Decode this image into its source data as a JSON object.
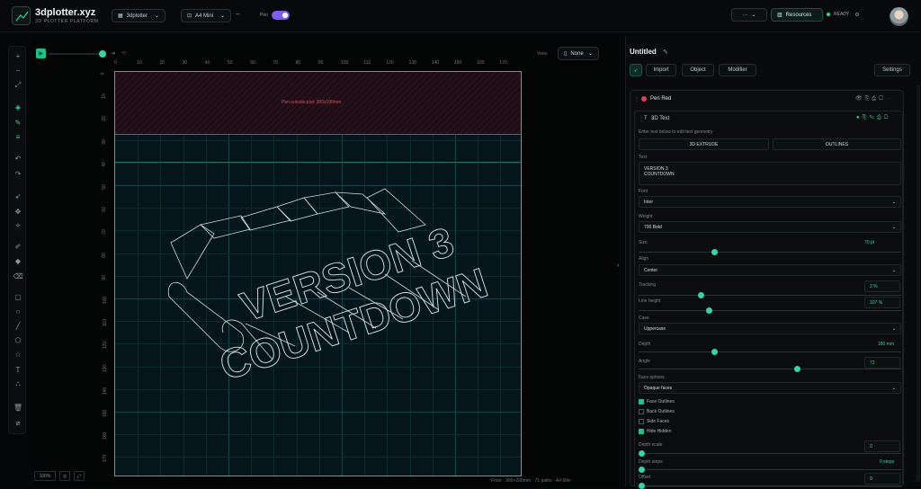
{
  "header": {
    "brand": "3dplotter.xyz",
    "brand_sub": "3D PLOTTER PLATFORM",
    "project_select": "3dplotter",
    "machine_select": "A4 Mini",
    "pen_label": "Pen",
    "menu_more": "···",
    "resources_label": "Resources",
    "status": "READY"
  },
  "canvas": {
    "view_label": "View:",
    "view_select": "None",
    "overflow_warning": "Pen outside plot: 300x190mm",
    "footer": "Front · 300×200mm · 71 paths · A4 Mini",
    "zoom": "100%"
  },
  "ruler": {
    "x": [
      "0",
      "10",
      "20",
      "30",
      "40",
      "50",
      "60",
      "70",
      "80",
      "90",
      "100",
      "110",
      "120",
      "130",
      "140",
      "150",
      "160",
      "170"
    ],
    "y": [
      "0",
      "10",
      "20",
      "30",
      "40",
      "50",
      "60",
      "70",
      "80",
      "90",
      "100",
      "110",
      "120",
      "130",
      "140",
      "150",
      "160",
      "170"
    ]
  },
  "artwork": {
    "line1": "VERSION 3",
    "line2": "COUNTDOWN"
  },
  "panel": {
    "title": "Untitled",
    "buttons": [
      "Import",
      "Object",
      "Modifier"
    ],
    "settings": "Settings",
    "layer_name": "Pen Red",
    "sublayer_name": "3D Text",
    "hint": "Enter text below to edit text geometry",
    "tab_a": "3D EXTRUDE",
    "tab_b": "OUTLINES",
    "text_label": "Text",
    "text_value_1": "VERSION 3",
    "text_value_2": "COUNTDOWN",
    "font_label": "Font",
    "font_value": "Inter",
    "weight_label": "Weight",
    "weight_value": "700 Bold",
    "size_label": "Size",
    "size_value": "70",
    "size_unit": "pt",
    "align_label": "Align",
    "align_value": "Center",
    "tracking_label": "Tracking",
    "tracking_value": "2",
    "tracking_unit": "%",
    "line_height_label": "Line height",
    "line_height_value": "107",
    "line_height_unit": "%",
    "case_label": "Case",
    "case_value": "Uppercase",
    "depth_label": "Depth",
    "depth_value": "180",
    "depth_unit": "mm",
    "angle_label": "Angle",
    "angle_value": "72",
    "faces_label": "Face options",
    "faces_value": "Opaque faces",
    "checks": [
      {
        "label": "Face Outlines",
        "on": true
      },
      {
        "label": "Back Outlines",
        "on": false
      },
      {
        "label": "Side Faces",
        "on": false
      },
      {
        "label": "Hide Hidden",
        "on": true
      }
    ],
    "depth_scale_label": "Depth scale",
    "depth_scale_value": "0",
    "depth_steps_label": "Depth steps",
    "depth_steps_value": "0",
    "depth_steps_unit": "steps",
    "offset_label": "Offset",
    "offset_value": "0",
    "slider_levels": {
      "size": 0.28,
      "tracking": 0.23,
      "line_height": 0.26,
      "depth": 0.28,
      "angle": 0.6,
      "depth_scale": 0.0,
      "depth_steps": 0.0,
      "offset": 0.0
    }
  },
  "colors": {
    "accent": "#2fd6a7",
    "toggle": "#7c5cf2",
    "plot_bg": "#04151b",
    "warning": "#d0505b",
    "pen_red": "#e0414d"
  }
}
